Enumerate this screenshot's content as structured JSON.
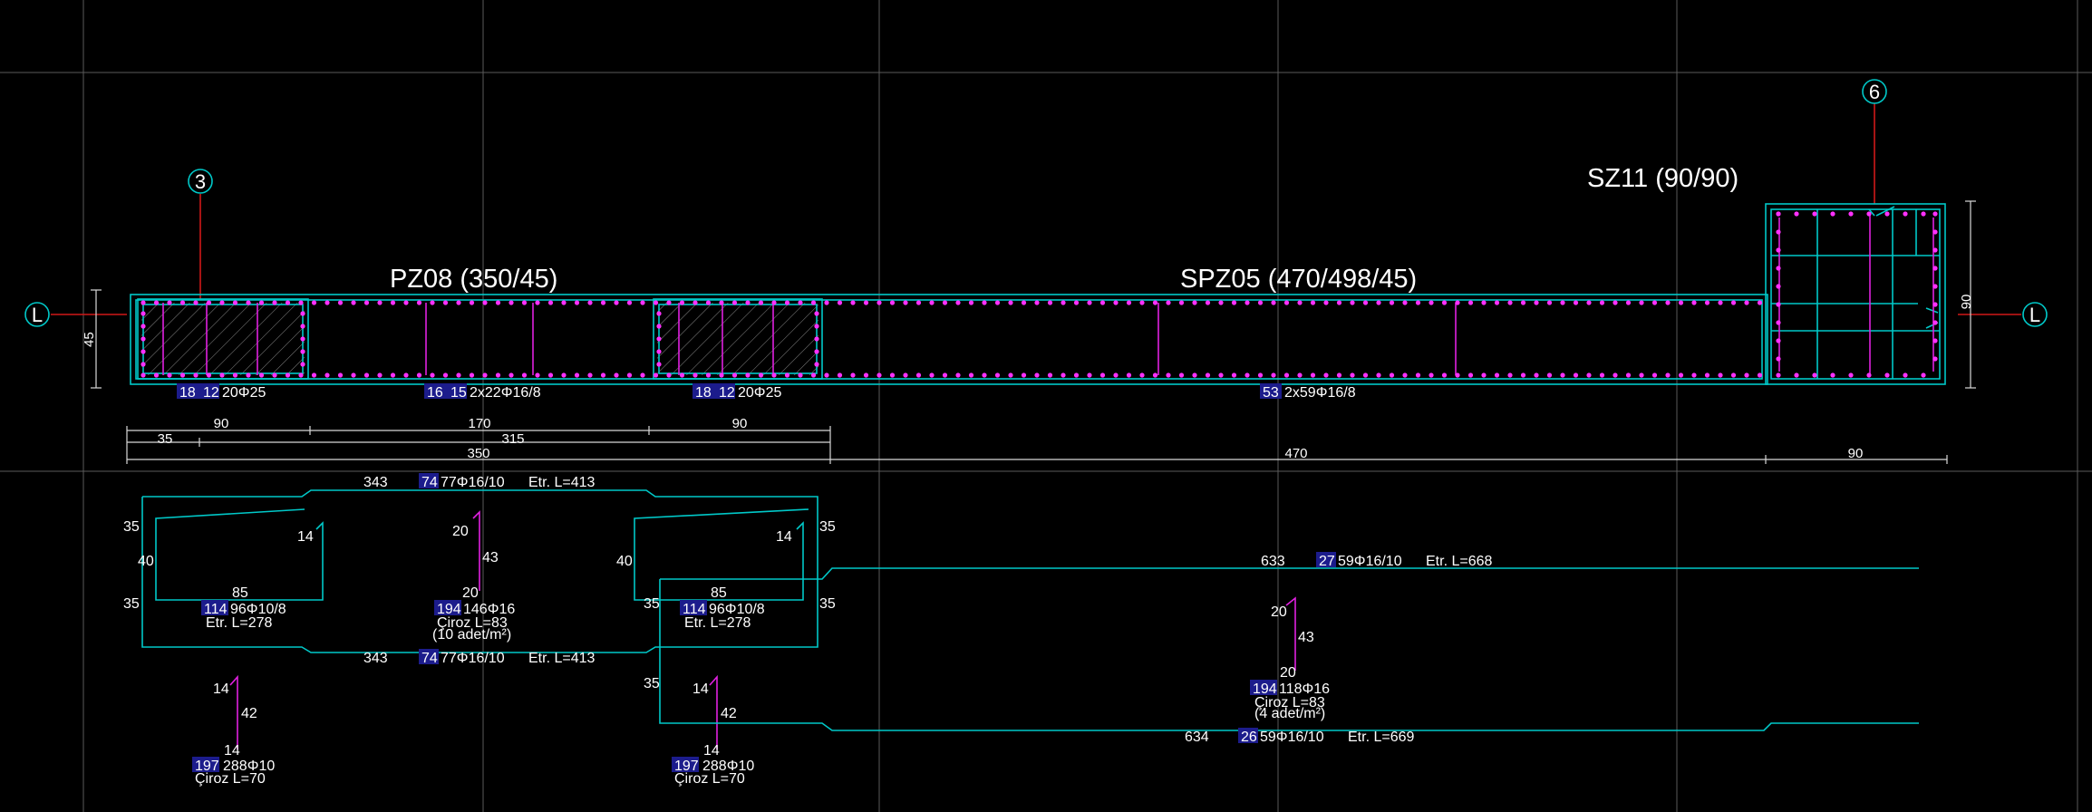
{
  "axes": [
    {
      "id": "3",
      "label": "3"
    },
    {
      "id": "6",
      "label": "6"
    },
    {
      "id": "L1",
      "label": "L"
    },
    {
      "id": "L2",
      "label": "L"
    }
  ],
  "members": {
    "pz08": "PZ08 (350/45)",
    "spz05": "SPZ05 (470/498/45)",
    "sz11": "SZ11 (90/90)"
  },
  "beam_labels": [
    {
      "tags": [
        "18",
        "12"
      ],
      "text": "20Φ25"
    },
    {
      "tags": [
        "16",
        "15"
      ],
      "text": "2x22Φ16/8"
    },
    {
      "tags": [
        "18",
        "12"
      ],
      "text": "20Φ25"
    },
    {
      "tags": [
        "53"
      ],
      "text": "2x59Φ16/8"
    }
  ],
  "dims": {
    "d45": "45",
    "d90v": "90",
    "row1": [
      "90",
      "170",
      "90"
    ],
    "row2": [
      "35",
      "315"
    ],
    "row3": [
      "350",
      "470",
      "90"
    ]
  },
  "rebar": {
    "top_left": {
      "len": "343",
      "tag": "74",
      "bars": "77Φ16/10",
      "etr": "Etr. L=413"
    },
    "bot_left": {
      "len": "343",
      "tag": "74",
      "bars": "77Φ16/10",
      "etr": "Etr. L=413"
    },
    "top_right": {
      "len": "633",
      "tag": "27",
      "bars": "59Φ16/10",
      "etr": "Etr. L=668"
    },
    "bot_right": {
      "len": "634",
      "tag": "26",
      "bars": "59Φ16/10",
      "etr": "Etr. L=669"
    },
    "stirrup_l": {
      "w": "85",
      "tag": "114",
      "bars": "96Φ10/8",
      "etr": "Etr. L=278",
      "s35a": "35",
      "s35b": "35",
      "s40": "40",
      "hook": "14"
    },
    "stirrup_r": {
      "w": "85",
      "tag": "114",
      "bars": "96Φ10/8",
      "etr": "Etr. L=278",
      "s35a": "35",
      "s35b": "35",
      "s40": "40",
      "hook": "14"
    },
    "ciroz1": {
      "a": "20",
      "b": "43",
      "c": "20",
      "tag": "194",
      "bars": "146Φ16",
      "len": "Çiroz L=83",
      "note": "(10 adet/m²)"
    },
    "ciroz2": {
      "a": "20",
      "b": "43",
      "c": "20",
      "tag": "194",
      "bars": "118Φ16",
      "len": "Çiroz L=83",
      "note": "(4 adet/m²)"
    },
    "pin_l": {
      "a": "14",
      "b": "42",
      "c": "14",
      "tag": "197",
      "bars": "288Φ10",
      "len": "Çiroz L=70"
    },
    "pin_r": {
      "a": "14",
      "b": "42",
      "c": "14",
      "tag": "197",
      "bars": "288Φ10",
      "len": "Çiroz L=70"
    },
    "side35": "35",
    "colors": {
      "cyan": "#00c8c8",
      "magenta": "#e020e0",
      "red": "#d01818",
      "tag": "#1c1c8c"
    }
  }
}
